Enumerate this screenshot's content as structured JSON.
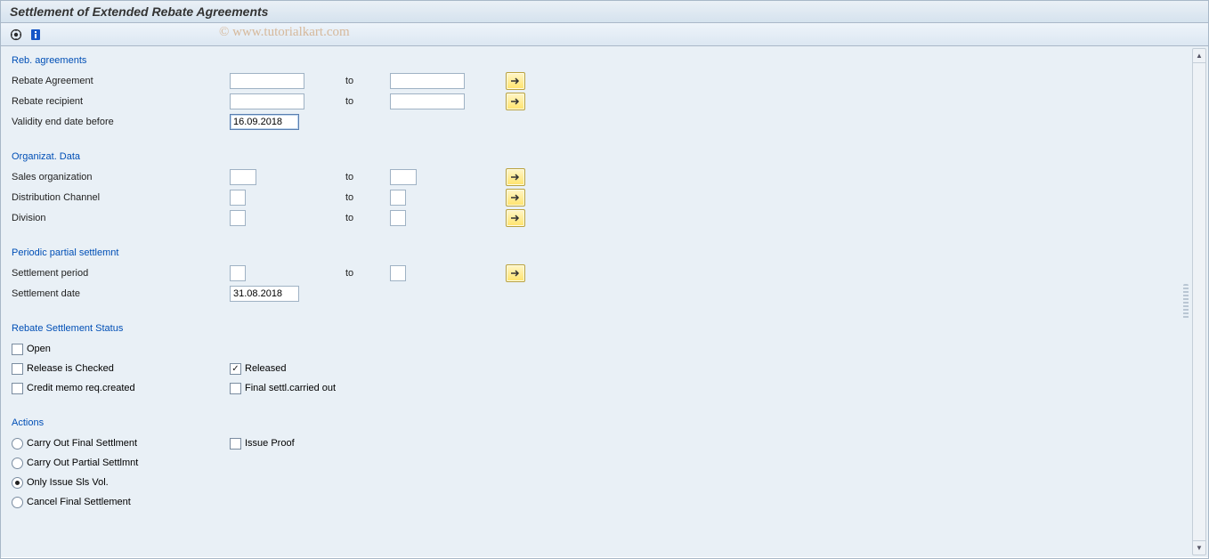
{
  "header": {
    "title": "Settlement of Extended Rebate Agreements"
  },
  "watermark": "© www.tutorialkart.com",
  "labels": {
    "to": "to"
  },
  "groups": {
    "reb": {
      "title": "Reb. agreements",
      "agreement": "Rebate Agreement",
      "recipient": "Rebate recipient",
      "validity": "Validity end date before",
      "validity_value": "16.09.2018"
    },
    "org": {
      "title": "Organizat. Data",
      "salesorg": "Sales organization",
      "distchannel": "Distribution Channel",
      "division": "Division"
    },
    "periodic": {
      "title": "Periodic partial settlemnt",
      "period": "Settlement period",
      "date": "Settlement date",
      "date_value": "31.08.2018"
    },
    "status": {
      "title": "Rebate Settlement Status",
      "open": "Open",
      "release_checked": "Release is Checked",
      "released": "Released",
      "credit_memo": "Credit memo req.created",
      "final_settl": "Final settl.carried out"
    },
    "actions": {
      "title": "Actions",
      "final": "Carry Out Final Settlment",
      "partial": "Carry Out Partial Settlmnt",
      "only_issue": "Only Issue Sls Vol.",
      "cancel": "Cancel Final Settlement",
      "issue_proof": "Issue Proof"
    }
  }
}
